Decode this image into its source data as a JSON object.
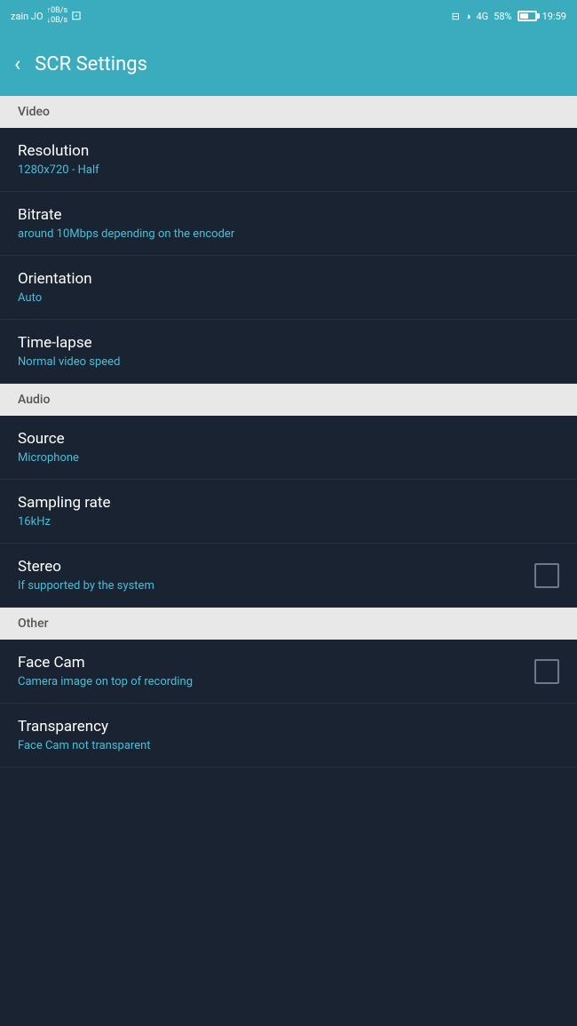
{
  "statusBar": {
    "carrier": "zain JO",
    "networkSpeed1": "↑0B/s",
    "networkSpeed2": "↓0B/s",
    "screenRecord": "⊡",
    "brightness": "◑",
    "network": "4G",
    "battery": "58%",
    "time": "19:59"
  },
  "appBar": {
    "title": "SCR Settings",
    "backLabel": "‹"
  },
  "sections": {
    "video": {
      "label": "Video",
      "items": [
        {
          "id": "resolution",
          "title": "Resolution",
          "subtitle": "1280x720 - Half",
          "hasCheckbox": false
        },
        {
          "id": "bitrate",
          "title": "Bitrate",
          "subtitle": "around 10Mbps depending on the encoder",
          "hasCheckbox": false
        },
        {
          "id": "orientation",
          "title": "Orientation",
          "subtitle": "Auto",
          "hasCheckbox": false
        },
        {
          "id": "timelapse",
          "title": "Time-lapse",
          "subtitle": "Normal video speed",
          "hasCheckbox": false
        }
      ]
    },
    "audio": {
      "label": "Audio",
      "items": [
        {
          "id": "source",
          "title": "Source",
          "subtitle": "Microphone",
          "hasCheckbox": false
        },
        {
          "id": "samplingrate",
          "title": "Sampling rate",
          "subtitle": "16kHz",
          "hasCheckbox": false
        },
        {
          "id": "stereo",
          "title": "Stereo",
          "subtitle": "If supported by the system",
          "hasCheckbox": true,
          "checked": false
        }
      ]
    },
    "other": {
      "label": "Other",
      "items": [
        {
          "id": "facecam",
          "title": "Face Cam",
          "subtitle": "Camera image on top of recording",
          "hasCheckbox": true,
          "checked": false
        },
        {
          "id": "transparency",
          "title": "Transparency",
          "subtitle": "Face Cam not transparent",
          "hasCheckbox": false
        }
      ]
    }
  }
}
